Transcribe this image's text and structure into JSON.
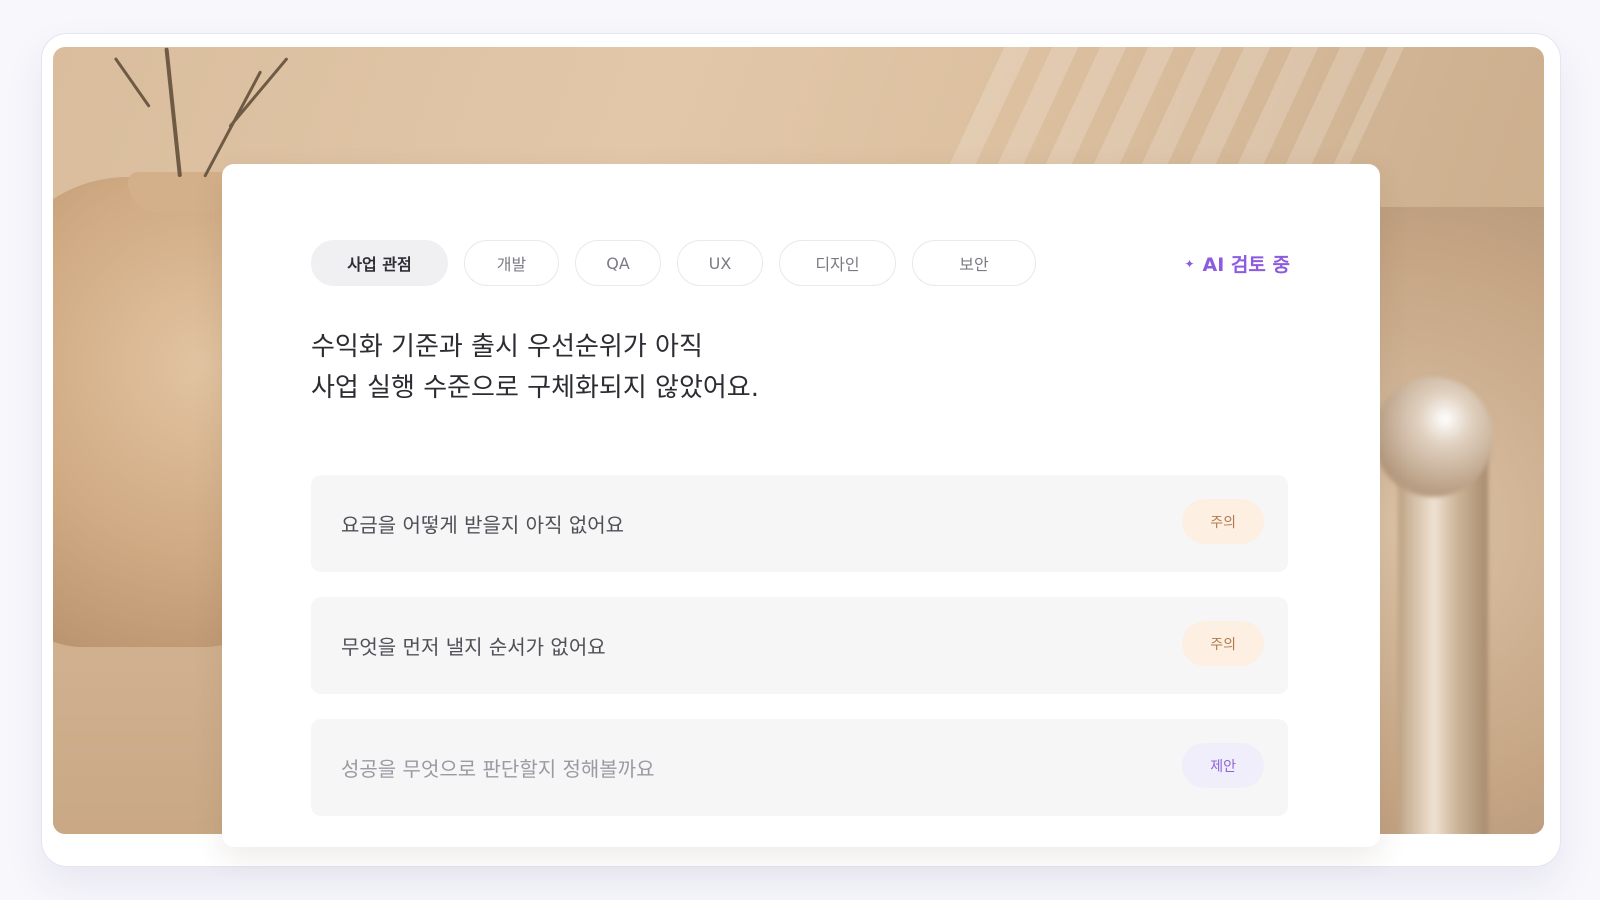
{
  "tabs": [
    {
      "label": "사업 관점",
      "active": true
    },
    {
      "label": "개발",
      "active": false
    },
    {
      "label": "QA",
      "active": false
    },
    {
      "label": "UX",
      "active": false
    },
    {
      "label": "디자인",
      "active": false
    },
    {
      "label": "보안",
      "active": false
    }
  ],
  "ai_status": {
    "icon": "sparkle-icon",
    "label": "AI 검토 중",
    "color": "#8c5be0"
  },
  "headline": {
    "line1": "수익화 기준과 출시 우선순위가 아직",
    "line2": "사업 실행 수준으로 구체화되지 않았어요."
  },
  "items": [
    {
      "text": "요금을 어떻게 받을지 아직 없어요",
      "badge": "주의",
      "type": "warn"
    },
    {
      "text": "무엇을 먼저 낼지 순서가 없어요",
      "badge": "주의",
      "type": "warn"
    },
    {
      "text": "성공을 무엇으로 판단할지 정해볼까요",
      "badge": "제안",
      "type": "suggest"
    }
  ],
  "colors": {
    "warn_bg": "#fdf0e3",
    "warn_text": "#b27a4b",
    "suggest_bg": "#f1eefb",
    "suggest_text": "#8c66d6"
  }
}
